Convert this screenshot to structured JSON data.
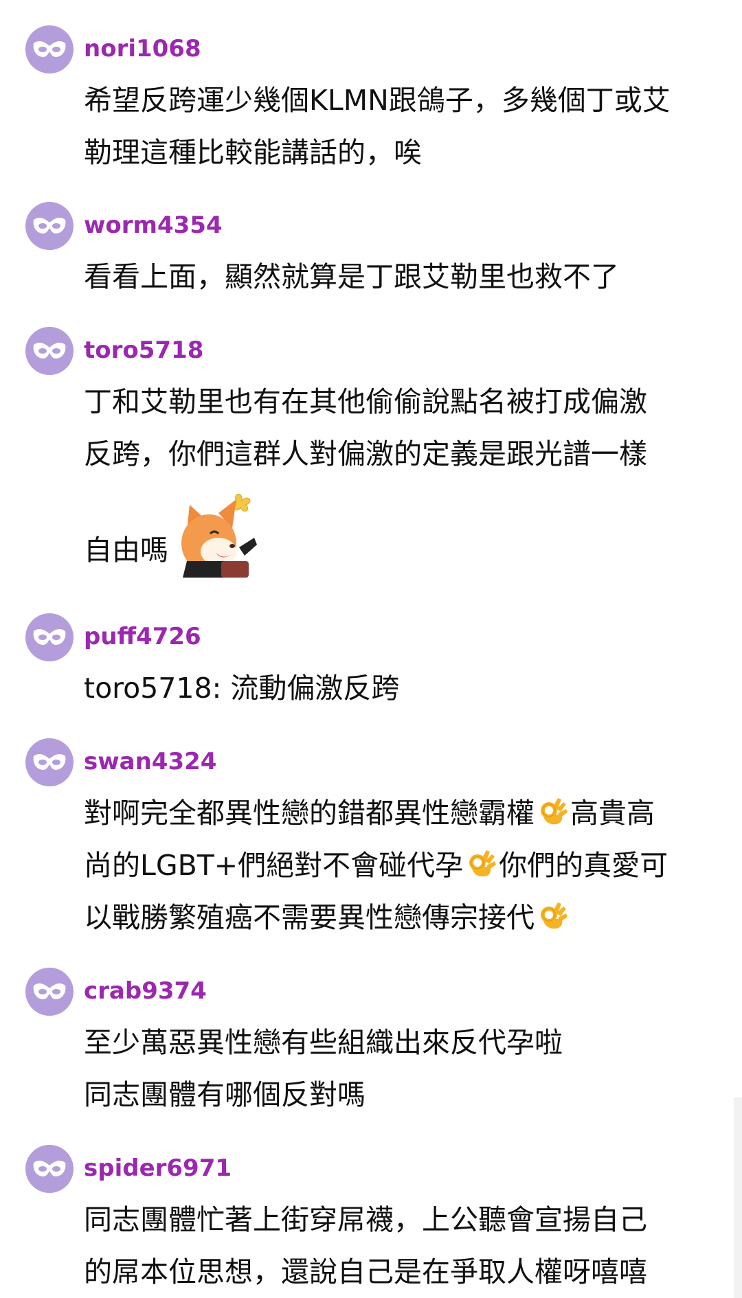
{
  "comments": [
    {
      "username": "nori1068",
      "lines": [
        "希望反跨運少幾個KLMN跟鴿子，多幾個丁或艾",
        "勒理這種比較能講話的，唉"
      ]
    },
    {
      "username": "worm4354",
      "lines": [
        "看看上面，顯然就算是丁跟艾勒里也救不了"
      ]
    },
    {
      "username": "toro5718",
      "lines": [
        "丁和艾勒里也有在其他偷偷說點名被打成偏激",
        "反跨，你們這群人對偏激的定義是跟光譜一樣"
      ],
      "sticker_line_text": "自由嗎",
      "sticker_icon": "fox-sticker"
    },
    {
      "username": "puff4726",
      "lines": [
        "toro5718: 流動偏激反跨"
      ]
    },
    {
      "username": "swan4324",
      "line1_a": "對啊完全都異性戀的錯都異性戀霸權",
      "line1_b": "高貴高",
      "line2_a": "尚的LGBT+們絕對不會碰代孕",
      "line2_b": "你們的真愛可",
      "line3_a": "以戰勝繁殖癌不需要異性戀傳宗接代",
      "emoji_icon": "ok-hand-emoji"
    },
    {
      "username": "crab9374",
      "lines": [
        "至少萬惡異性戀有些組織出來反代孕啦",
        "同志團體有哪個反對嗎"
      ]
    },
    {
      "username": "spider6971",
      "lines": [
        "同志團體忙著上街穿屌襪，上公聽會宣揚自己",
        "的屌本位思想，還說自己是在爭取人權呀嘻嘻"
      ]
    }
  ],
  "avatar_icon": "mask-icon",
  "colors": {
    "username": "#9c27b0",
    "avatar_bg": "#b39ddb",
    "text": "#111111"
  }
}
